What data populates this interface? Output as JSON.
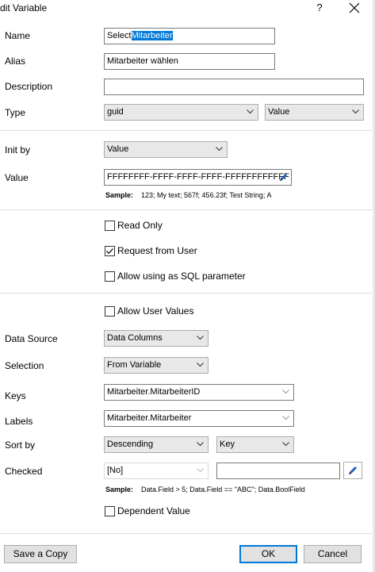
{
  "window": {
    "title": "dit Variable",
    "help_glyph": "?"
  },
  "fields": {
    "name_label": "Name",
    "name_value_plain": "Select",
    "name_value_selected": "Mitarbeiter",
    "alias_label": "Alias",
    "alias_value": "Mitarbeiter wählen",
    "description_label": "Description",
    "description_value": "",
    "type_label": "Type",
    "type_value": "guid",
    "type_kind": "Value",
    "initby_label": "Init by",
    "initby_value": "Value",
    "value_label": "Value",
    "value_value": "FFFFFFFF-FFFF-FFFF-FFFF-FFFFFFFFFFFF",
    "sample_label": "Sample:",
    "sample_text": "123; My text; 567f; 456.23f; Test String; A"
  },
  "options": {
    "read_only": {
      "label": "Read Only",
      "checked": false
    },
    "request_from_user": {
      "label": "Request from User",
      "checked": true
    },
    "sql_parameter": {
      "label": "Allow using as SQL parameter",
      "checked": false
    },
    "allow_user_values": {
      "label": "Allow User Values",
      "checked": false
    },
    "dependent_value": {
      "label": "Dependent Value",
      "checked": false
    }
  },
  "datasource": {
    "data_source_label": "Data Source",
    "data_source_value": "Data Columns",
    "selection_label": "Selection",
    "selection_value": "From Variable",
    "keys_label": "Keys",
    "keys_value": "Mitarbeiter.MitarbeiterID",
    "labels_label": "Labels",
    "labels_value": "Mitarbeiter.Mitarbeiter",
    "sortby_label": "Sort by",
    "sortby_value": "Descending",
    "sortby_field": "Key",
    "checked_label": "Checked",
    "checked_value": "[No]",
    "checked_expr": "",
    "sample_label": "Sample:",
    "sample_text": "Data.Field > 5; Data.Field == \"ABC\"; Data.BoolField"
  },
  "buttons": {
    "save_copy": "Save a Copy",
    "ok": "OK",
    "cancel": "Cancel"
  }
}
